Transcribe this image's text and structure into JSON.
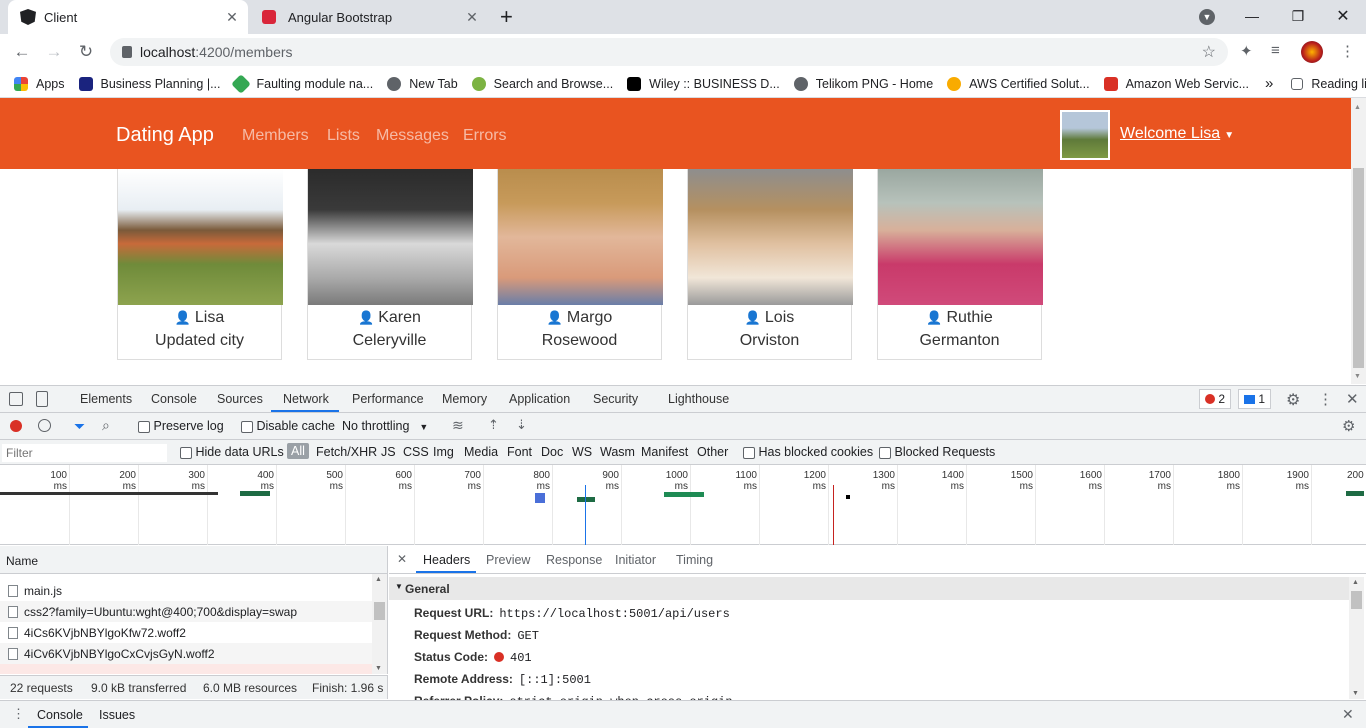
{
  "browser": {
    "tabs": [
      {
        "title": "Client",
        "icon": "angular-icon"
      },
      {
        "title": "Angular Bootstrap",
        "icon": "bootstrap-icon"
      }
    ],
    "new_tab": "+",
    "url_host": "localhost",
    "url_rest": ":4200/members",
    "bookmarks": [
      {
        "label": "Apps",
        "color": "#4285f4"
      },
      {
        "label": "Business Planning |...",
        "color": "#1a237e"
      },
      {
        "label": "Faulting module na...",
        "color": "#34a853"
      },
      {
        "label": "New Tab",
        "color": "#5f6368"
      },
      {
        "label": "Search and Browse...",
        "color": "#7cb342"
      },
      {
        "label": "Wiley :: BUSINESS D...",
        "color": "#000000"
      },
      {
        "label": "Telikom PNG - Home",
        "color": "#5f6368"
      },
      {
        "label": "AWS Certified Solut...",
        "color": "#f9ab00"
      },
      {
        "label": "Amazon Web Servic...",
        "color": "#d93025"
      }
    ],
    "bookmarks_more": "»",
    "reading_list": "Reading list"
  },
  "app": {
    "brand": "Dating App",
    "nav": [
      "Members",
      "Lists",
      "Messages",
      "Errors"
    ],
    "welcome": "Welcome Lisa",
    "accent": "#e95420",
    "members": [
      {
        "name": "Lisa",
        "city": "Updated city",
        "photo": "linear-gradient(#ffffff 0%,#e8eef3 30%,#7a5a3a 45%,#c86a3a 55%,#6f8b3a 70%,#8da34e 100%)"
      },
      {
        "name": "Karen",
        "city": "Celeryville",
        "photo": "linear-gradient(#2b2b2b 0%,#3a3a3a 30%,#d9d9d9 55%,#aaaaaa 80%,#7a7a7a 100%)"
      },
      {
        "name": "Margo",
        "city": "Rosewood",
        "photo": "linear-gradient(#b98d4d 0%,#c79a5a 25%,#e2b79a 50%,#d99a7a 80%,#6a7ea8 100%)"
      },
      {
        "name": "Lois",
        "city": "Orviston",
        "photo": "linear-gradient(#8e8e8e 0%,#b59060 30%,#e0c0a0 55%,#f1e6d8 80%,#9a9a9a 100%)"
      },
      {
        "name": "Ruthie",
        "city": "Germanton",
        "photo": "linear-gradient(#9aa7a0 0%,#b7c2bb 25%,#d8b09a 45%,#c93a6a 70%,#d04a7a 100%)"
      }
    ]
  },
  "devtools": {
    "tabs": [
      "Elements",
      "Console",
      "Sources",
      "Network",
      "Performance",
      "Memory",
      "Application",
      "Security",
      "Lighthouse"
    ],
    "error_count": "2",
    "message_count": "1",
    "preserve_log": "Preserve log",
    "disable_cache": "Disable cache",
    "throttling": "No throttling",
    "filter_placeholder": "Filter",
    "hide_data_urls": "Hide data URLs",
    "type_filters": [
      "All",
      "Fetch/XHR",
      "JS",
      "CSS",
      "Img",
      "Media",
      "Font",
      "Doc",
      "WS",
      "Wasm",
      "Manifest",
      "Other"
    ],
    "has_blocked_cookies": "Has blocked cookies",
    "blocked_requests": "Blocked Requests",
    "timeline_ticks": [
      "100 ms",
      "200 ms",
      "300 ms",
      "400 ms",
      "500 ms",
      "600 ms",
      "700 ms",
      "800 ms",
      "900 ms",
      "1000 ms",
      "1100 ms",
      "1200 ms",
      "1300 ms",
      "1400 ms",
      "1500 ms",
      "1600 ms",
      "1700 ms",
      "1800 ms",
      "1900 ms",
      "200"
    ],
    "name_header": "Name",
    "requests": [
      "main.js",
      "css2?family=Ubuntu:wght@400;700&display=swap",
      "4iCs6KVjbNBYlgoKfw72.woff2",
      "4iCv6KVjbNBYlgoCxCvjsGyN.woff2"
    ],
    "summary": {
      "requests": "22 requests",
      "transferred": "9.0 kB transferred",
      "resources": "6.0 MB resources",
      "finish": "Finish: 1.96 s"
    },
    "detail_tabs": [
      "Headers",
      "Preview",
      "Response",
      "Initiator",
      "Timing"
    ],
    "general_label": "General",
    "headers": [
      {
        "label": "Request URL:",
        "value": "https://localhost:5001/api/users"
      },
      {
        "label": "Request Method:",
        "value": "GET"
      },
      {
        "label": "Status Code:",
        "value": "401"
      },
      {
        "label": "Remote Address:",
        "value": "[::1]:5001"
      },
      {
        "label": "Referrer Policy:",
        "value": "strict-origin-when-cross-origin"
      }
    ],
    "drawer_tabs": [
      "Console",
      "Issues"
    ]
  }
}
